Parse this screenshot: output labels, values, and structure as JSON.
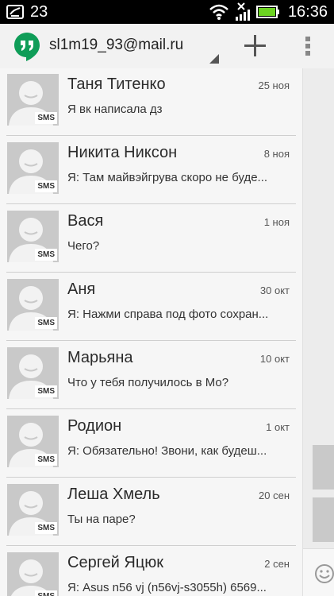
{
  "status_bar": {
    "notification_count": "23",
    "time": "16:36",
    "icons": [
      "notification-icon",
      "wifi-icon",
      "signal-icon",
      "battery-icon"
    ]
  },
  "action_bar": {
    "account": "sl1m19_93@mail.ru",
    "icons": [
      "hangouts-logo-icon",
      "dropdown-caret-icon",
      "plus-icon",
      "overflow-menu-icon"
    ]
  },
  "conversations": [
    {
      "name": "Таня Титенко",
      "date": "25 ноя",
      "snippet": "Я вк написала дз",
      "badge": "SMS"
    },
    {
      "name": "Никита Никсон",
      "date": "8 ноя",
      "snippet": "Я: Там майвэйгрува скоро не буде...",
      "badge": "SMS"
    },
    {
      "name": "Вася",
      "date": "1 ноя",
      "snippet": "Чего?",
      "badge": "SMS"
    },
    {
      "name": "Аня",
      "date": "30 окт",
      "snippet": "Я: Нажми справа под фото сохран...",
      "badge": "SMS"
    },
    {
      "name": "Марьяна",
      "date": "10 окт",
      "snippet": "Что у тебя получилось в Мо?",
      "badge": "SMS"
    },
    {
      "name": "Родион",
      "date": "1 окт",
      "snippet": "Я: Обязательно! Звони, как будеш...",
      "badge": "SMS"
    },
    {
      "name": "Леша Хмель",
      "date": "20 сен",
      "snippet": "Ты на паре?",
      "badge": "SMS"
    },
    {
      "name": "Сергей Яцюк",
      "date": "2 сен",
      "snippet": "Я: Asus n56 vj (n56vj-s3055h) 6569...",
      "badge": "SMS"
    }
  ],
  "colors": {
    "hangouts_green": "#0f9d58",
    "avatar_gray": "#c9c9c9",
    "status_bar": "#000000"
  }
}
